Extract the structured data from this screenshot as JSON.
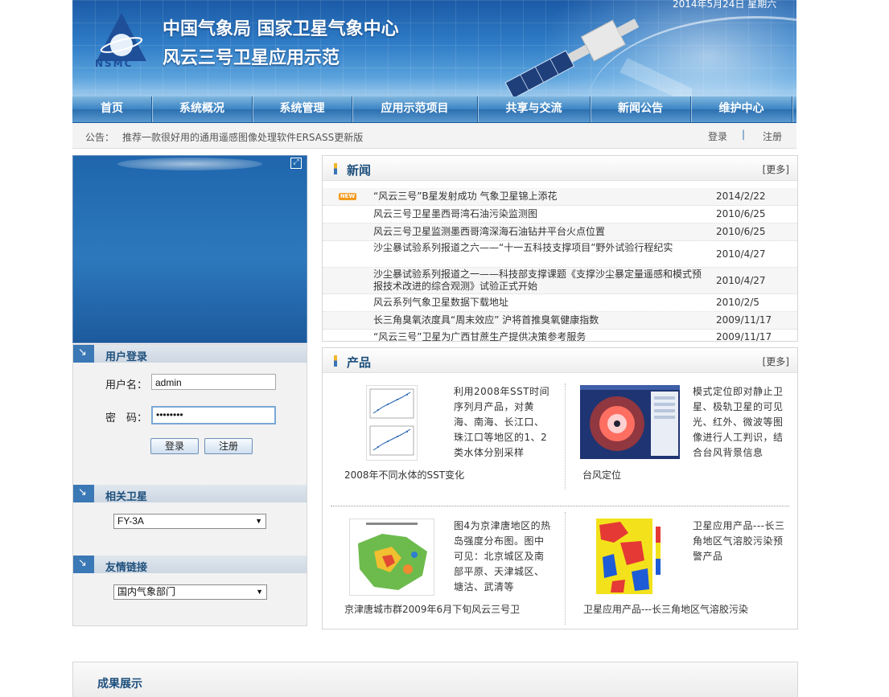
{
  "header": {
    "title_line1": "中国气象局 国家卫星气象中心",
    "title_line2": "风云三号卫星应用示范",
    "logo_text": "NSMC",
    "date": "2014年5月24日 星期六"
  },
  "nav": {
    "items": [
      {
        "label": "首页"
      },
      {
        "label": "系统概况"
      },
      {
        "label": "系统管理"
      },
      {
        "label": "应用示范项目"
      },
      {
        "label": "共享与交流"
      },
      {
        "label": "新闻公告"
      },
      {
        "label": "维护中心"
      }
    ]
  },
  "notice": {
    "label": "公告：",
    "text": "推荐一款很好用的通用遥感图像处理软件ERSASS更新版",
    "login": "登录",
    "separator": "|",
    "register": "注册"
  },
  "login": {
    "section_title": "用户登录",
    "username_label": "用户名：",
    "username_value": "admin",
    "password_label": "密　码：",
    "password_value": "••••••••",
    "login_button": "登录",
    "register_button": "注册"
  },
  "satellite": {
    "section_title": "相关卫星",
    "selected": "FY-3A"
  },
  "links": {
    "section_title": "友情链接",
    "selected": "国内气象部门"
  },
  "news": {
    "title": "新闻",
    "more": "[更多]",
    "badge": "NEW",
    "items": [
      {
        "title": "“风云三号”B星发射成功 气象卫星锦上添花",
        "date": "2014/2/22"
      },
      {
        "title": "风云三号卫星墨西哥湾石油污染监测图",
        "date": "2010/6/25"
      },
      {
        "title": "风云三号卫星监测墨西哥湾深海石油钻井平台火点位置",
        "date": "2010/6/25"
      },
      {
        "title": "沙尘暴试验系列报道之六——“十一五科技支撑项目”野外试验行程纪实",
        "date": "2010/4/27"
      },
      {
        "title": "沙尘暴试验系列报道之一——科技部支撑课题《支撑沙尘暴定量遥感和模式预报技术改进的综合观测》试验正式开始",
        "date": "2010/4/27"
      },
      {
        "title": "风云系列气象卫星数据下载地址",
        "date": "2010/2/5"
      },
      {
        "title": "长三角臭氧浓度具“周末效应” 沪将首推臭氧健康指数",
        "date": "2009/11/17"
      },
      {
        "title": "“风云三号”卫星为广西甘蔗生产提供决策参考服务",
        "date": "2009/11/17"
      }
    ]
  },
  "products": {
    "title": "产品",
    "more": "[更多]",
    "items": [
      {
        "desc": "利用2008年SST时间序列月产品，对黄海、南海、长江口、珠江口等地区的1、2类水体分别采样",
        "caption": "2008年不同水体的SST变化"
      },
      {
        "desc": "模式定位即对静止卫星、极轨卫星的可见光、红外、微波等图像进行人工判识，结合台风背景信息",
        "caption": "台风定位"
      },
      {
        "desc": "图4为京津唐地区的热岛强度分布图。图中可见：北京城区及南部平原、天津城区、塘沽、武清等",
        "caption": "京津唐城市群2009年6月下旬风云三号卫"
      },
      {
        "desc": "卫星应用产品---长三角地区气溶胶污染预警产品",
        "caption": "卫星应用产品---长三角地区气溶胶污染"
      }
    ]
  },
  "showcase": {
    "title": "成果展示"
  },
  "colors": {
    "brand_blue": "#2c6fb0",
    "title_blue": "#1d4f7c",
    "accent_orange": "#f2b52d"
  }
}
